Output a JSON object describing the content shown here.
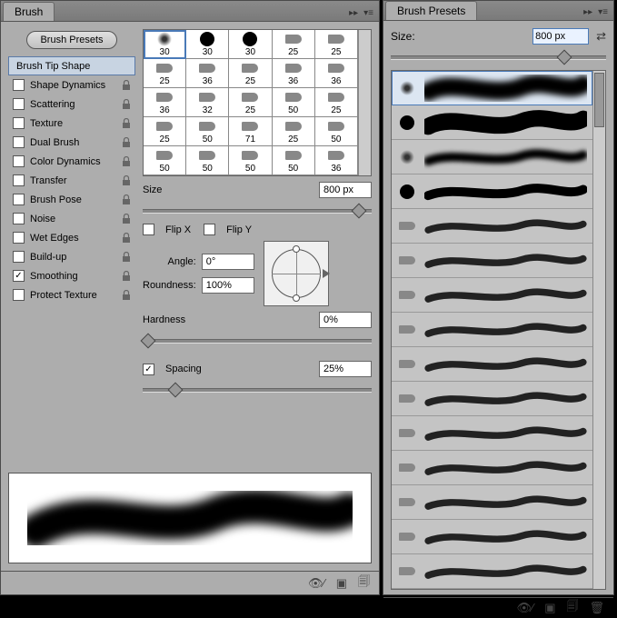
{
  "brush_panel": {
    "tab": "Brush",
    "presets_button": "Brush Presets",
    "options": [
      {
        "label": "Brush Tip Shape",
        "checkbox": false,
        "checked": false,
        "locked": false,
        "selected": true
      },
      {
        "label": "Shape Dynamics",
        "checkbox": true,
        "checked": false,
        "locked": true
      },
      {
        "label": "Scattering",
        "checkbox": true,
        "checked": false,
        "locked": true
      },
      {
        "label": "Texture",
        "checkbox": true,
        "checked": false,
        "locked": true
      },
      {
        "label": "Dual Brush",
        "checkbox": true,
        "checked": false,
        "locked": true
      },
      {
        "label": "Color Dynamics",
        "checkbox": true,
        "checked": false,
        "locked": true
      },
      {
        "label": "Transfer",
        "checkbox": true,
        "checked": false,
        "locked": true
      },
      {
        "label": "Brush Pose",
        "checkbox": true,
        "checked": false,
        "locked": true
      },
      {
        "label": "Noise",
        "checkbox": true,
        "checked": false,
        "locked": true
      },
      {
        "label": "Wet Edges",
        "checkbox": true,
        "checked": false,
        "locked": true
      },
      {
        "label": "Build-up",
        "checkbox": true,
        "checked": false,
        "locked": true
      },
      {
        "label": "Smoothing",
        "checkbox": true,
        "checked": true,
        "locked": true
      },
      {
        "label": "Protect Texture",
        "checkbox": true,
        "checked": false,
        "locked": true
      }
    ],
    "tip_grid": [
      [
        {
          "v": "30",
          "t": "soft",
          "sel": true
        },
        {
          "v": "30",
          "t": "hard"
        },
        {
          "v": "30",
          "t": "hard"
        },
        {
          "v": "25",
          "t": "tip"
        },
        {
          "v": "25",
          "t": "tip"
        }
      ],
      [
        {
          "v": "25",
          "t": "tip"
        },
        {
          "v": "36",
          "t": "tip"
        },
        {
          "v": "25",
          "t": "tip"
        },
        {
          "v": "36",
          "t": "tip"
        },
        {
          "v": "36",
          "t": "tip"
        }
      ],
      [
        {
          "v": "36",
          "t": "tip"
        },
        {
          "v": "32",
          "t": "tip"
        },
        {
          "v": "25",
          "t": "tip"
        },
        {
          "v": "50",
          "t": "tip"
        },
        {
          "v": "25",
          "t": "tip"
        }
      ],
      [
        {
          "v": "25",
          "t": "tip"
        },
        {
          "v": "50",
          "t": "tip"
        },
        {
          "v": "71",
          "t": "tip"
        },
        {
          "v": "25",
          "t": "tip"
        },
        {
          "v": "50",
          "t": "tip"
        }
      ],
      [
        {
          "v": "50",
          "t": "tip"
        },
        {
          "v": "50",
          "t": "tip"
        },
        {
          "v": "50",
          "t": "tip"
        },
        {
          "v": "50",
          "t": "tip"
        },
        {
          "v": "36",
          "t": "tip"
        }
      ]
    ],
    "size_label": "Size",
    "size_value": "800 px",
    "flip_x": "Flip X",
    "flip_y": "Flip Y",
    "angle_label": "Angle:",
    "angle_value": "0°",
    "roundness_label": "Roundness:",
    "roundness_value": "100%",
    "hardness_label": "Hardness",
    "hardness_value": "0%",
    "spacing_label": "Spacing",
    "spacing_value": "25%",
    "spacing_checked": true
  },
  "presets_panel": {
    "tab": "Brush Presets",
    "size_label": "Size:",
    "size_value": "800 px",
    "items": [
      {
        "t": "soft",
        "sel": true
      },
      {
        "t": "hard"
      },
      {
        "t": "softsm"
      },
      {
        "t": "hardsm"
      },
      {
        "t": "tip1"
      },
      {
        "t": "tip2"
      },
      {
        "t": "tip3"
      },
      {
        "t": "tip4"
      },
      {
        "t": "tip5"
      },
      {
        "t": "tip6"
      },
      {
        "t": "tip7"
      },
      {
        "t": "tip8"
      },
      {
        "t": "tip9"
      },
      {
        "t": "tip10"
      },
      {
        "t": "tip11"
      }
    ]
  }
}
